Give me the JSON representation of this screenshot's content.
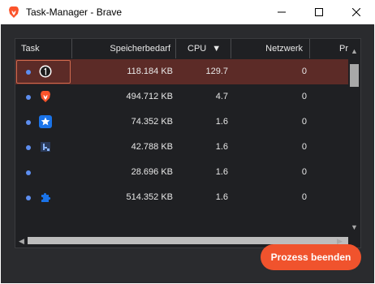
{
  "window": {
    "title": "Task-Manager - Brave",
    "app_icon": "brave-lion-icon",
    "controls": [
      "minimize-icon",
      "maximize-icon",
      "close-icon"
    ]
  },
  "table": {
    "columns": [
      "Task",
      "Speicherbedarf",
      "CPU",
      "Netzwerk",
      "Pr"
    ],
    "sort_column": "CPU",
    "sort_indicator": "▼",
    "rows": [
      {
        "icon": "tab-favicon-icon",
        "memory": "118.184 KB",
        "cpu": "129.7",
        "network": "0",
        "selected": true
      },
      {
        "icon": "brave-lion-icon",
        "memory": "494.712 KB",
        "cpu": "4.7",
        "network": "0",
        "selected": false
      },
      {
        "icon": "star-extension-icon",
        "memory": "74.352 KB",
        "cpu": "1.6",
        "network": "0",
        "selected": false
      },
      {
        "icon": "utility-process-icon",
        "memory": "42.788 KB",
        "cpu": "1.6",
        "network": "0",
        "selected": false
      },
      {
        "icon": "",
        "memory": "28.696 KB",
        "cpu": "1.6",
        "network": "0",
        "selected": false
      },
      {
        "icon": "puzzle-extension-icon",
        "memory": "514.352 KB",
        "cpu": "1.6",
        "network": "0",
        "selected": false
      }
    ]
  },
  "footer": {
    "end_button_label": "Prozess beenden"
  },
  "colors": {
    "accent": "#f0532d",
    "selection": "#5c2b27",
    "background": "#2a2b2e",
    "dot": "#5d8ef0"
  }
}
